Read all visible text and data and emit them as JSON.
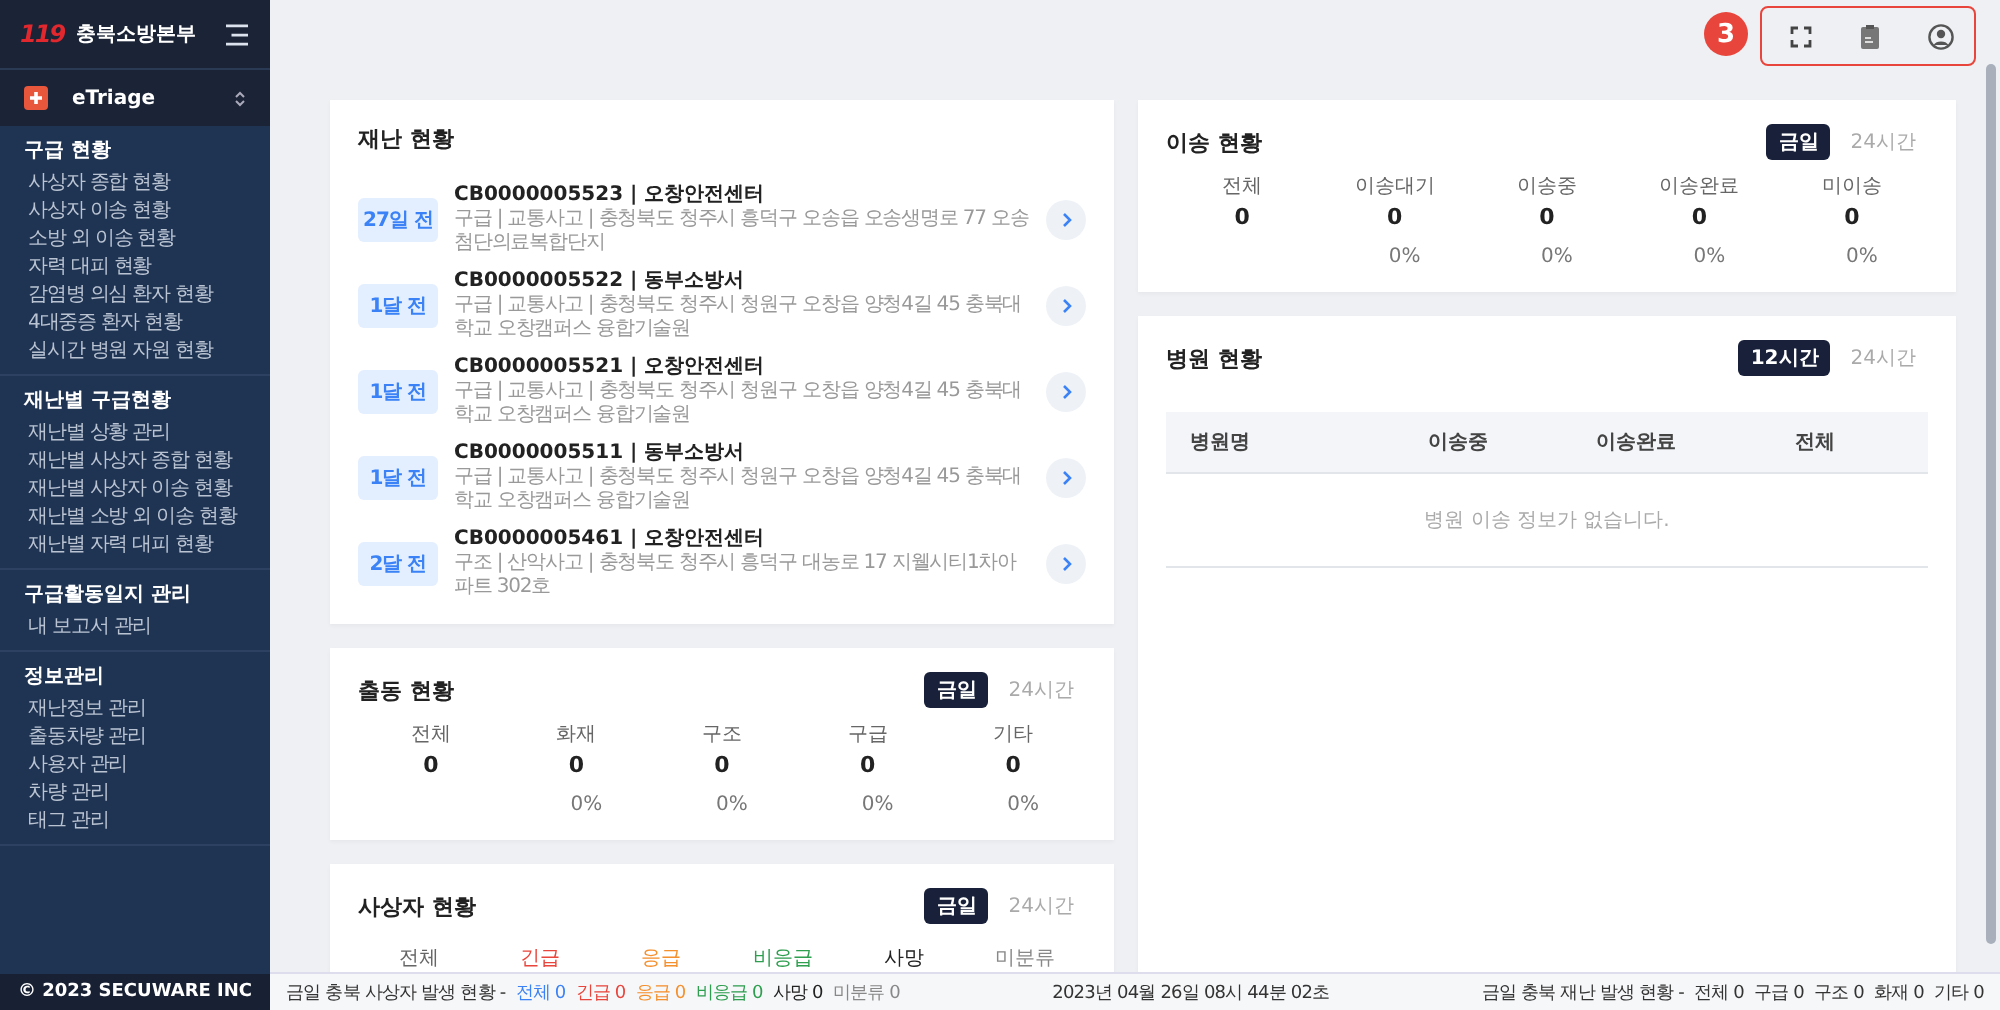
{
  "brand": {
    "logo": "119",
    "org": "충북소방본부"
  },
  "app_switcher": {
    "label": "eTriage"
  },
  "nav": [
    {
      "title": "구급 현황",
      "items": [
        "사상자 종합 현황",
        "사상자 이송 현황",
        "소방 외 이송 현황",
        "자력 대피 현황",
        "감염병 의심 환자 현황",
        "4대중증 환자 현황",
        "실시간 병원 자원 현황"
      ]
    },
    {
      "title": "재난별 구급현황",
      "items": [
        "재난별 상황 관리",
        "재난별 사상자 종합 현황",
        "재난별 사상자 이송 현황",
        "재난별 소방 외 이송 현황",
        "재난별 자력 대피 현황"
      ]
    },
    {
      "title": "구급활동일지 관리",
      "items": [
        "내 보고서 관리"
      ]
    },
    {
      "title": "정보관리",
      "items": [
        "재난정보 관리",
        "출동차량 관리",
        "사용자 관리",
        "차량 관리",
        "태그 관리"
      ]
    }
  ],
  "copyright": "© 2023 SECUWARE INC",
  "annotation": {
    "number": "3"
  },
  "disasters": {
    "title": "재난 현황",
    "items": [
      {
        "ago": "27일 전",
        "title": "CB0000005523 | 오창안전센터",
        "detail": "구급 | 교통사고 | 충청북도 청주시 흥덕구 오송읍 오송생명로 77 오송첨단의료복합단지"
      },
      {
        "ago": "1달 전",
        "title": "CB0000005522 | 동부소방서",
        "detail": "구급 | 교통사고 | 충청북도 청주시 청원구 오창읍 양청4길 45 충북대학교 오창캠퍼스 융합기술원"
      },
      {
        "ago": "1달 전",
        "title": "CB0000005521 | 오창안전센터",
        "detail": "구급 | 교통사고 | 충청북도 청주시 청원구 오창읍 양청4길 45 충북대학교 오창캠퍼스 융합기술원"
      },
      {
        "ago": "1달 전",
        "title": "CB0000005511 | 동부소방서",
        "detail": "구급 | 교통사고 | 충청북도 청주시 청원구 오창읍 양청4길 45 충북대학교 오창캠퍼스 융합기술원"
      },
      {
        "ago": "2달 전",
        "title": "CB0000005461 | 오창안전센터",
        "detail": "구조 | 산악사고 | 충청북도 청주시 흥덕구 대농로 17 지웰시티1차아파트 302호"
      }
    ]
  },
  "dispatch": {
    "title": "출동 현황",
    "tabs": [
      {
        "label": "금일",
        "selected": true
      },
      {
        "label": "24시간",
        "selected": false
      }
    ],
    "stats": [
      {
        "label": "전체",
        "value": "0"
      },
      {
        "label": "화재",
        "value": "0",
        "percent": "0%"
      },
      {
        "label": "구조",
        "value": "0",
        "percent": "0%"
      },
      {
        "label": "구급",
        "value": "0",
        "percent": "0%"
      },
      {
        "label": "기타",
        "value": "0",
        "percent": "0%"
      }
    ]
  },
  "casualties": {
    "title": "사상자 현황",
    "tabs": [
      {
        "label": "금일",
        "selected": true
      },
      {
        "label": "24시간",
        "selected": false
      }
    ],
    "categories": [
      {
        "label": "전체",
        "color": "#666666"
      },
      {
        "label": "긴급",
        "color": "#e8453c"
      },
      {
        "label": "응급",
        "color": "#f5902e"
      },
      {
        "label": "비응급",
        "color": "#2e9e4f"
      },
      {
        "label": "사망",
        "color": "#222222"
      },
      {
        "label": "미분류",
        "color": "#888888"
      }
    ]
  },
  "transfer": {
    "title": "이송 현황",
    "tabs": [
      {
        "label": "금일",
        "selected": true
      },
      {
        "label": "24시간",
        "selected": false
      }
    ],
    "stats": [
      {
        "label": "전체",
        "value": "0"
      },
      {
        "label": "이송대기",
        "value": "0",
        "percent": "0%"
      },
      {
        "label": "이송중",
        "value": "0",
        "percent": "0%"
      },
      {
        "label": "이송완료",
        "value": "0",
        "percent": "0%"
      },
      {
        "label": "미이송",
        "value": "0",
        "percent": "0%"
      }
    ]
  },
  "hospitals": {
    "title": "병원 현황",
    "tabs": [
      {
        "label": "12시간",
        "selected": true
      },
      {
        "label": "24시간",
        "selected": false
      }
    ],
    "columns": [
      "병원명",
      "이송중",
      "이송완료",
      "전체"
    ],
    "empty": "병원 이송 정보가 없습니다."
  },
  "status_bar": {
    "casualty_label": "금일 충북 사상자 발생 현황 -",
    "casualty_items": [
      {
        "text": "전체 0",
        "color": "#3b82f6"
      },
      {
        "text": "긴급 0",
        "color": "#e8453c"
      },
      {
        "text": "응급 0",
        "color": "#f5902e"
      },
      {
        "text": "비응급 0",
        "color": "#2e9e4f"
      },
      {
        "text": "사망 0",
        "color": "#222222"
      },
      {
        "text": "미분류 0",
        "color": "#888888"
      }
    ],
    "datetime": "2023년 04월 26일 08시 44분 02초",
    "disaster_label": "금일 충북 재난 발생 현황 -",
    "disaster_items": [
      "전체 0",
      "구급 0",
      "구조 0",
      "화재 0",
      "기타 0"
    ]
  }
}
